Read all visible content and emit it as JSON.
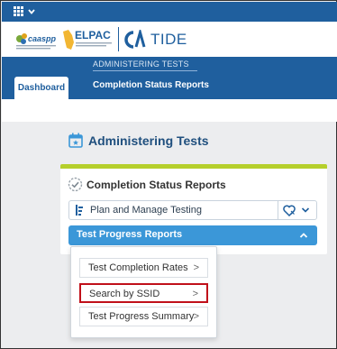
{
  "header": {
    "brand_title": "TIDE",
    "logo_caaspp_text": "caaspp",
    "logo_elpac_text": "ELPAC",
    "logo_ca_text": "CA"
  },
  "nav": {
    "dashboard_tab": "Dashboard",
    "section_label": "ADMINISTERING TESTS",
    "current_item": "Completion Status Reports"
  },
  "page": {
    "title": "Administering Tests"
  },
  "card": {
    "title": "Completion Status Reports",
    "dropdown_plan": "Plan and Manage Testing",
    "dropdown_progress": "Test Progress Reports"
  },
  "menu": {
    "items": [
      {
        "label": "Test Completion Rates",
        "arrow": ">"
      },
      {
        "label": "Search by SSID",
        "arrow": ">"
      },
      {
        "label": "Test Progress Summary",
        "arrow": ">"
      }
    ]
  },
  "colors": {
    "brand_blue": "#1f5f9e",
    "accent_blue": "#3b97d8",
    "card_accent": "#b5cf2b",
    "highlight": "#c0101a"
  },
  "icons": {
    "apps": "apps-grid-icon",
    "calendar": "calendar-star-icon",
    "check": "check-circle-icon",
    "favorite": "heart-icon"
  }
}
